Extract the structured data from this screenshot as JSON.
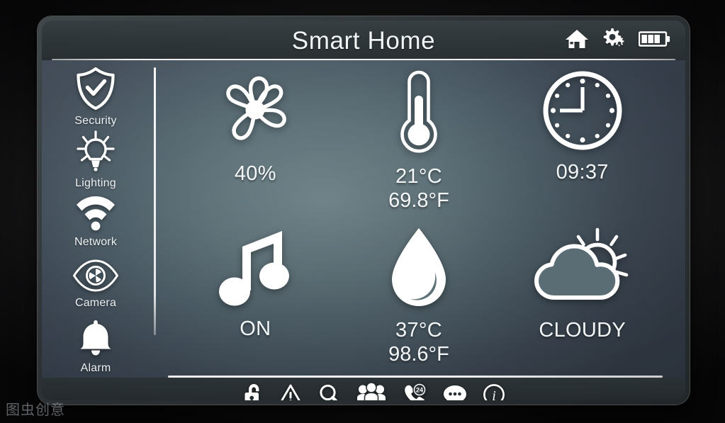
{
  "header": {
    "title": "Smart Home",
    "icons": [
      {
        "name": "home-icon",
        "label": "Home"
      },
      {
        "name": "settings-gears-icon",
        "label": "Settings"
      },
      {
        "name": "battery-icon",
        "label": "Battery",
        "level_bars": 3,
        "total_bars": 4
      }
    ]
  },
  "sidebar": {
    "items": [
      {
        "label": "Security",
        "icon": "shield-check-icon"
      },
      {
        "label": "Lighting",
        "icon": "lightbulb-icon"
      },
      {
        "label": "Network",
        "icon": "wifi-icon"
      },
      {
        "label": "Camera",
        "icon": "eye-camera-icon"
      },
      {
        "label": "Alarm",
        "icon": "bell-icon"
      }
    ]
  },
  "main": {
    "tiles": [
      {
        "icon": "fan-flower-icon",
        "name": "fan-speed-tile",
        "value": "40%",
        "value2": ""
      },
      {
        "icon": "thermometer-icon",
        "name": "temperature-tile",
        "value": "21°C",
        "value2": "69.8°F"
      },
      {
        "icon": "clock-icon",
        "name": "clock-tile",
        "value": "09:37",
        "value2": ""
      },
      {
        "icon": "music-note-icon",
        "name": "music-tile",
        "value": "ON",
        "value2": ""
      },
      {
        "icon": "water-drop-icon",
        "name": "water-temperature-tile",
        "value": "37°C",
        "value2": "98.6°F"
      },
      {
        "icon": "sun-cloud-icon",
        "name": "weather-tile",
        "value": "CLOUDY",
        "value2": ""
      }
    ]
  },
  "toolbar": {
    "icons": [
      {
        "name": "padlock-icon",
        "label": "Lock"
      },
      {
        "name": "warning-triangle-icon",
        "label": "Warning"
      },
      {
        "name": "magnifier-icon",
        "label": "Search"
      },
      {
        "name": "users-group-icon",
        "label": "Users"
      },
      {
        "name": "phone-24h-icon",
        "label": "24 Hour Support",
        "badge": "24"
      },
      {
        "name": "chat-bubble-icon",
        "label": "Messages"
      },
      {
        "name": "info-circle-icon",
        "label": "Info"
      }
    ]
  },
  "watermark": {
    "text": "图虫创意"
  },
  "colors": {
    "screen_light": "#6d8288",
    "screen_dark": "#343d49",
    "bezel": "#2b3134",
    "icon_white": "#ffffff",
    "header_bar": "#2d3437"
  }
}
